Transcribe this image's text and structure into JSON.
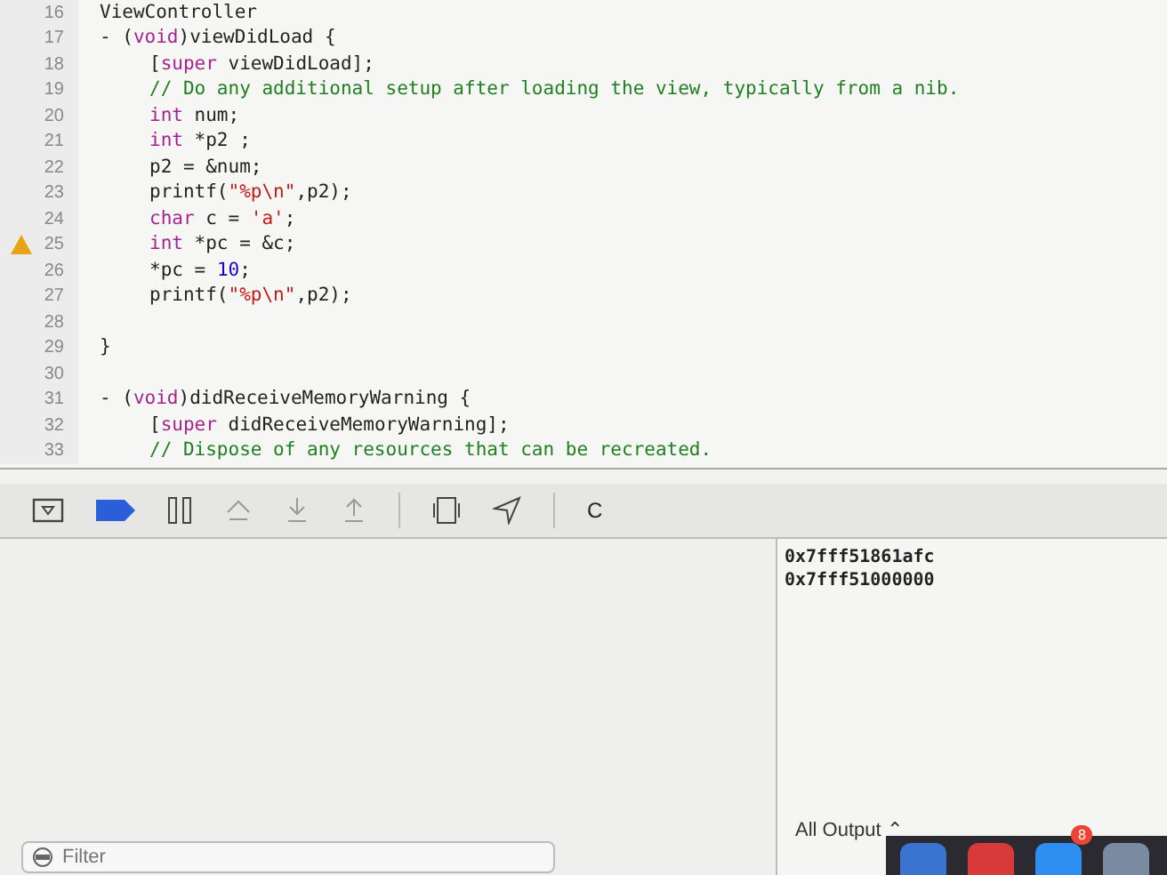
{
  "editor": {
    "lines": [
      {
        "number": "16",
        "warning": false,
        "indented": false,
        "tokens": [
          {
            "kind": "txt",
            "text": "ViewController"
          }
        ]
      },
      {
        "number": "17",
        "warning": false,
        "indented": false,
        "tokens": [
          {
            "kind": "txt",
            "text": "- ("
          },
          {
            "kind": "kw",
            "text": "void"
          },
          {
            "kind": "txt",
            "text": ")viewDidLoad {"
          }
        ]
      },
      {
        "number": "18",
        "warning": false,
        "indented": true,
        "tokens": [
          {
            "kind": "txt",
            "text": "["
          },
          {
            "kind": "kw",
            "text": "super"
          },
          {
            "kind": "txt",
            "text": " viewDidLoad];"
          }
        ]
      },
      {
        "number": "19",
        "warning": false,
        "indented": true,
        "tokens": [
          {
            "kind": "cmt",
            "text": "// Do any additional setup after loading the view, typically from a nib."
          }
        ]
      },
      {
        "number": "20",
        "warning": false,
        "indented": true,
        "tokens": [
          {
            "kind": "kw",
            "text": "int"
          },
          {
            "kind": "txt",
            "text": " num;"
          }
        ]
      },
      {
        "number": "21",
        "warning": false,
        "indented": true,
        "tokens": [
          {
            "kind": "kw",
            "text": "int"
          },
          {
            "kind": "txt",
            "text": " *p2 ;"
          }
        ]
      },
      {
        "number": "22",
        "warning": false,
        "indented": true,
        "tokens": [
          {
            "kind": "txt",
            "text": "p2 = &num;"
          }
        ]
      },
      {
        "number": "23",
        "warning": false,
        "indented": true,
        "tokens": [
          {
            "kind": "txt",
            "text": "printf("
          },
          {
            "kind": "str",
            "text": "\"%p\\n\""
          },
          {
            "kind": "txt",
            "text": ",p2);"
          }
        ]
      },
      {
        "number": "24",
        "warning": false,
        "indented": true,
        "tokens": [
          {
            "kind": "kw",
            "text": "char"
          },
          {
            "kind": "txt",
            "text": " c = "
          },
          {
            "kind": "str",
            "text": "'a'"
          },
          {
            "kind": "txt",
            "text": ";"
          }
        ]
      },
      {
        "number": "25",
        "warning": true,
        "indented": true,
        "tokens": [
          {
            "kind": "kw",
            "text": "int"
          },
          {
            "kind": "txt",
            "text": " *pc = &c;"
          }
        ]
      },
      {
        "number": "26",
        "warning": false,
        "indented": true,
        "tokens": [
          {
            "kind": "txt",
            "text": "*pc = "
          },
          {
            "kind": "num",
            "text": "10"
          },
          {
            "kind": "txt",
            "text": ";"
          }
        ]
      },
      {
        "number": "27",
        "warning": false,
        "indented": true,
        "tokens": [
          {
            "kind": "txt",
            "text": "printf("
          },
          {
            "kind": "str",
            "text": "\"%p\\n\""
          },
          {
            "kind": "txt",
            "text": ",p2);"
          }
        ]
      },
      {
        "number": "28",
        "warning": false
      },
      {
        "number": "29",
        "warning": false,
        "indented": false,
        "tokens": [
          {
            "kind": "txt",
            "text": "}"
          }
        ]
      },
      {
        "number": "30",
        "warning": false
      },
      {
        "number": "31",
        "warning": false,
        "indented": false,
        "tokens": [
          {
            "kind": "txt",
            "text": "- ("
          },
          {
            "kind": "kw",
            "text": "void"
          },
          {
            "kind": "txt",
            "text": ")didReceiveMemoryWarning {"
          }
        ]
      },
      {
        "number": "32",
        "warning": false,
        "indented": true,
        "tokens": [
          {
            "kind": "txt",
            "text": "["
          },
          {
            "kind": "kw",
            "text": "super"
          },
          {
            "kind": "txt",
            "text": " didReceiveMemoryWarning];"
          }
        ]
      },
      {
        "number": "33",
        "warning": false,
        "indented": true,
        "tokens": [
          {
            "kind": "cmt",
            "text": "// Dispose of any resources that can be recreated."
          }
        ]
      }
    ]
  },
  "debug_bar": {
    "breakpoints_active": true,
    "frame_label": "C"
  },
  "console": {
    "output": [
      "0x7fff51861afc",
      "0x7fff51000000"
    ],
    "output_selector": "All Output ⌃"
  },
  "variables": {
    "filter_placeholder": "Filter"
  },
  "dock": {
    "badge": "8"
  }
}
